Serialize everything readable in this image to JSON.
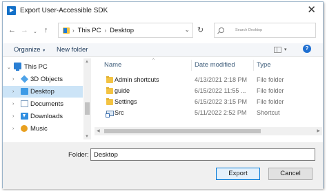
{
  "window": {
    "title": "Export User-Accessible SDK"
  },
  "address": {
    "crumbs": [
      "This PC",
      "Desktop"
    ]
  },
  "search": {
    "placeholder": "Search Desktop"
  },
  "commands": {
    "organize": "Organize",
    "new_folder": "New folder"
  },
  "nav": {
    "items": [
      {
        "label": "This PC",
        "icon": "computer-icon",
        "expander": "down"
      },
      {
        "label": "3D Objects",
        "icon": "3d-objects-icon",
        "expander": "right"
      },
      {
        "label": "Desktop",
        "icon": "desktop-icon",
        "expander": "right",
        "selected": true
      },
      {
        "label": "Documents",
        "icon": "documents-icon",
        "expander": "right"
      },
      {
        "label": "Downloads",
        "icon": "downloads-icon",
        "expander": "right"
      },
      {
        "label": "Music",
        "icon": "music-icon",
        "expander": "right"
      }
    ]
  },
  "columns": {
    "name": "Name",
    "date": "Date modified",
    "type": "Type"
  },
  "files": [
    {
      "name": "Admin shortcuts",
      "date": "4/13/2021 2:18 PM",
      "type": "File folder",
      "icon": "folder-icon"
    },
    {
      "name": "guide",
      "date": "6/15/2022 11:55 ...",
      "type": "File folder",
      "icon": "folder-icon"
    },
    {
      "name": "Settings",
      "date": "6/15/2022 3:15 PM",
      "type": "File folder",
      "icon": "folder-icon"
    },
    {
      "name": "Src",
      "date": "5/11/2022 2:52 PM",
      "type": "Shortcut",
      "icon": "shortcut-icon"
    }
  ],
  "footer": {
    "folder_label": "Folder:",
    "folder_value": "Desktop",
    "export_label": "Export",
    "cancel_label": "Cancel"
  },
  "colors": {
    "accent": "#0078d7",
    "selection": "#cce4f7",
    "folder": "#f3c343"
  }
}
